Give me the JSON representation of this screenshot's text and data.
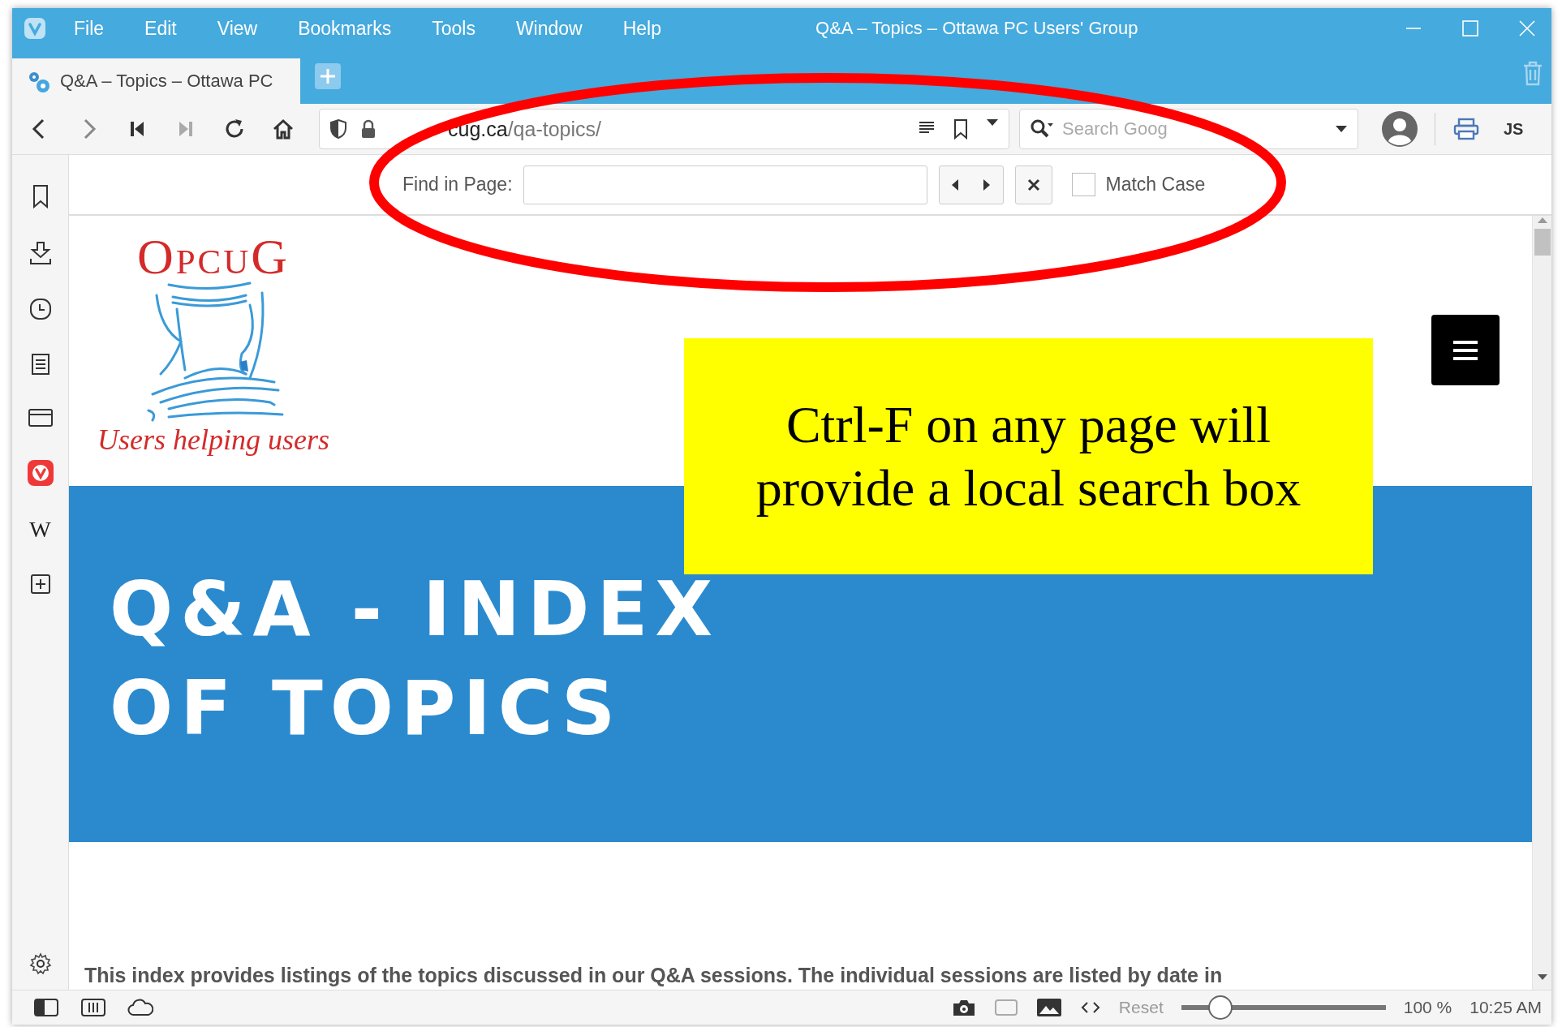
{
  "menu_bar": {
    "items": [
      "File",
      "Edit",
      "View",
      "Bookmarks",
      "Tools",
      "Window",
      "Help"
    ]
  },
  "window": {
    "title": "Q&A – Topics – Ottawa PC Users' Group"
  },
  "tabs": [
    {
      "label": "Q&A – Topics – Ottawa PC",
      "selected": true
    }
  ],
  "address_bar": {
    "domain": "cug.ca",
    "path": "/qa-topics/"
  },
  "search_field": {
    "placeholder": "Search Goog"
  },
  "toolbar": {
    "js_label": "JS"
  },
  "find_bar": {
    "label": "Find in Page:",
    "match_case": {
      "label": "Match Case",
      "checked": false
    }
  },
  "sidebar": {
    "web_panel_glyph": "W"
  },
  "page": {
    "logo": {
      "title": "OpcuG",
      "tagline": "Users helping users"
    },
    "banner": {
      "lines": [
        "Q&A - INDEX",
        "OF TOPICS"
      ]
    },
    "intro": "This index provides listings of the topics discussed in our Q&A sessions. The individual sessions are listed by date in"
  },
  "annotation": {
    "text": "Ctrl-F on any page will provide a local search box"
  },
  "status_bar": {
    "reset": "Reset",
    "zoom": {
      "level": 0.19
    },
    "zoom_reading": "100 %",
    "time": "10:25 AM"
  }
}
